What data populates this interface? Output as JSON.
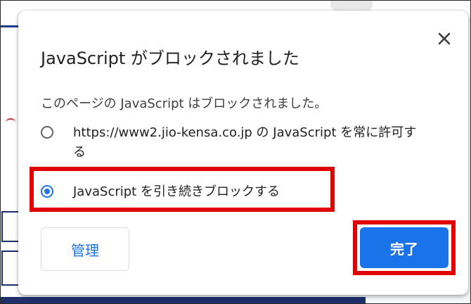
{
  "dialog": {
    "title": "JavaScript がブロックされました",
    "description": "このページの JavaScript はブロックされました。",
    "close_icon": "close-icon",
    "options": [
      {
        "label": "https://www2.jio-kensa.co.jp の JavaScript を常に許可する",
        "selected": false
      },
      {
        "label": "JavaScript を引き続きブロックする",
        "selected": true
      }
    ],
    "manage_label": "管理",
    "done_label": "完了"
  },
  "colors": {
    "accent": "#1a73e8",
    "highlight": "#e00000",
    "text": "#202124"
  }
}
